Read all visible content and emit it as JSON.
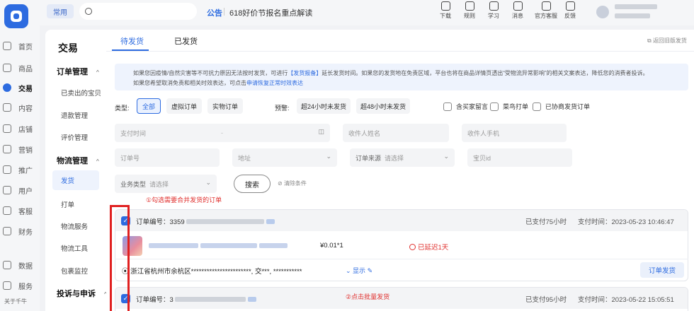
{
  "app": {
    "logo": "taobao-seller-logo",
    "tag": "常用",
    "search_placeholder": ""
  },
  "top": {
    "notice_label": "公告",
    "notice_text": "618好价节报名重点解读",
    "icons": [
      {
        "icon": "download-icon",
        "label": "下载"
      },
      {
        "icon": "rule-icon",
        "label": "规则"
      },
      {
        "icon": "study-icon",
        "label": "学习"
      },
      {
        "icon": "message-icon",
        "label": "消息"
      },
      {
        "icon": "service-icon",
        "label": "官方客服"
      },
      {
        "icon": "feedback-icon",
        "label": "反馈"
      }
    ]
  },
  "rail": {
    "items": [
      "首页",
      "商品",
      "交易",
      "内容",
      "店铺",
      "营销",
      "推广",
      "用户",
      "客服",
      "财务",
      "数据",
      "服务"
    ],
    "active": "交易",
    "footer": "关于千牛"
  },
  "subnav": {
    "title": "交易",
    "groups": [
      {
        "label": "订单管理",
        "items": [
          "已卖出的宝贝",
          "退款管理",
          "评价管理"
        ]
      },
      {
        "label": "物流管理",
        "items": [
          "发货",
          "打单",
          "物流服务",
          "物流工具",
          "包裹监控"
        ]
      },
      {
        "label": "投诉与申诉",
        "items": []
      }
    ],
    "active": "发货"
  },
  "tabs": [
    "待发货",
    "已发货"
  ],
  "old_link": "返回旧版发货",
  "info": {
    "line1_a": "如果您因疫情/自然灾害等不可抗力原因无法按时发货，可进行",
    "line1_link": "【发货报备】",
    "line1_b": "延长发货时间。如果您的发货地在免责区域，平台也将在商品详情页透出“受物流异常影响”的相关文案表达，降低您的消费者投诉。",
    "line2_a": "如果您希望取消免责和相关时效表达，可点击",
    "line2_link": "申请恢复正常时效表达"
  },
  "filters": {
    "type_label": "类型:",
    "types": [
      "全部",
      "虚拟订单",
      "实物订单"
    ],
    "warn_label": "预警:",
    "warns": [
      "超24小时未发货",
      "超48小时未发货"
    ],
    "checks": [
      "含买家留言",
      "菜鸟打单",
      "已协商发货订单"
    ],
    "pay_time": "支付时间",
    "buyer_name": "收件人姓名",
    "buyer_phone": "收件人手机",
    "order_no": "订单号",
    "address": "地址",
    "source_label": "订单来源",
    "source_value": "请选择",
    "item_id": "宝贝id",
    "biz_label": "业务类型",
    "biz_value": "请选择",
    "search": "搜索",
    "clear": "清除条件"
  },
  "annotations": {
    "note1": "①勾选需要合并发货的订单",
    "note2": "②点击批量发货"
  },
  "orders": [
    {
      "no_label": "订单编号：",
      "no": "3359",
      "paid": "已支付75小时",
      "time_label": "支付时间：",
      "time": "2023-05-23 10:46:47",
      "price": "¥0.01*1",
      "late": "已延迟1天",
      "address": "浙江省杭州市余杭区***********************, 交***, ***********",
      "show": "显示",
      "ship": "订单发货"
    },
    {
      "no_label": "订单编号：",
      "no": "3",
      "paid": "已支付95小时",
      "time_label": "支付时间：",
      "time": "2023-05-22 15:05:51"
    }
  ],
  "colors": {
    "accent": "#2d6be0",
    "warn": "#e0302e"
  }
}
